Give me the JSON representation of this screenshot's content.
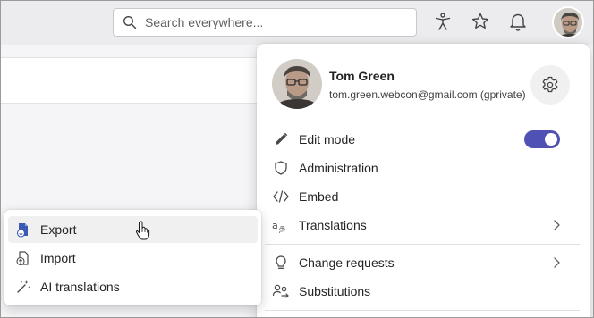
{
  "topbar": {
    "search": {
      "placeholder": "Search everywhere..."
    },
    "icons": [
      "accessibility-icon",
      "star-icon",
      "bell-icon"
    ]
  },
  "profile": {
    "name": "Tom Green",
    "email": "tom.green.webcon@gmail.com (gprivate)"
  },
  "menu": {
    "edit_mode": {
      "label": "Edit mode",
      "enabled": true
    },
    "administration": {
      "label": "Administration"
    },
    "embed": {
      "label": "Embed"
    },
    "translations": {
      "label": "Translations"
    },
    "change_requests": {
      "label": "Change requests"
    },
    "substitutions": {
      "label": "Substitutions"
    }
  },
  "submenu": {
    "export": {
      "label": "Export"
    },
    "import": {
      "label": "Import"
    },
    "ai_translations": {
      "label": "AI translations"
    }
  },
  "colors": {
    "accent": "#4f52b2",
    "hover": "#f0f0f0"
  }
}
